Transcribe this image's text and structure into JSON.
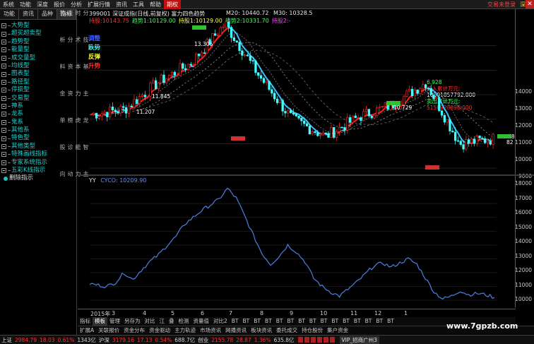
{
  "menu": {
    "items": [
      "系统",
      "功能",
      "深度",
      "报价",
      "分析",
      "扩展行情",
      "资讯",
      "工具",
      "帮助",
      "期权"
    ],
    "active_index": 9,
    "right_items": [
      "交易未登录",
      "深证"
    ]
  },
  "sidebar": {
    "tabs": [
      "功能",
      "资讯",
      "品种",
      "指标"
    ],
    "active_tab": 3,
    "tree": [
      {
        "label": "大势型",
        "type": "node"
      },
      {
        "label": "超买超卖型",
        "type": "node"
      },
      {
        "label": "趋势型",
        "type": "node"
      },
      {
        "label": "能量型",
        "type": "node"
      },
      {
        "label": "成交量型",
        "type": "node"
      },
      {
        "label": "均线型",
        "type": "node"
      },
      {
        "label": "图表型",
        "type": "node"
      },
      {
        "label": "路径型",
        "type": "node"
      },
      {
        "label": "停损型",
        "type": "node"
      },
      {
        "label": "交易型",
        "type": "node"
      },
      {
        "label": "神系",
        "type": "node"
      },
      {
        "label": "龙系",
        "type": "node"
      },
      {
        "label": "鬼系",
        "type": "node"
      },
      {
        "label": "其他系",
        "type": "node"
      },
      {
        "label": "特色型",
        "type": "node"
      },
      {
        "label": "其他类型",
        "type": "node"
      },
      {
        "label": "特殊画线指标",
        "type": "node"
      },
      {
        "label": "专家系统指示",
        "type": "node"
      },
      {
        "label": "五彩K线指示",
        "type": "node"
      },
      {
        "label": "删除指示",
        "type": "leaf"
      }
    ]
  },
  "side_vertical_labels": [
    "分时走势",
    "技术分析",
    "基本资料",
    "主力资金",
    "龙虎榜单",
    "智能诊股",
    "主力动向"
  ],
  "upper_header": {
    "code_name": "399001  深证成指(日线,前复权)  富力四色趋势",
    "ma_row": [
      {
        "label": "M20:",
        "value": "10440.72",
        "color": "#e8e8e8"
      },
      {
        "label": "M30:",
        "value": "10328.5",
        "color": "#e8e8e8"
      }
    ],
    "row2": [
      {
        "label": "持股:",
        "value": "10143.75",
        "color": "#ff3030"
      },
      {
        "label": "趋势1:",
        "value": "10129.00",
        "color": "#40ff60"
      },
      {
        "label": "持股1:",
        "value": "10129.00",
        "color": "#ffff40"
      },
      {
        "label": "趋势2:",
        "value": "10331.70",
        "color": "#40ff60"
      },
      {
        "label": "持股2:",
        "value": "-",
        "color": "#ff40ff"
      }
    ]
  },
  "legend": [
    {
      "label": "调整",
      "color": "#4060ff"
    },
    {
      "label": "跌势",
      "color": "#40ffff"
    },
    {
      "label": "反弹",
      "color": "#ffff40"
    },
    {
      "label": "升势",
      "color": "#ff3030"
    }
  ],
  "stats_card": [
    {
      "text": "6.928",
      "color": "#40ff60"
    },
    {
      "text": "买入累计万元:",
      "color": "#ff3030"
    },
    {
      "text": "10301857792.000",
      "color": "#ffffff"
    },
    {
      "text": "卖出累计万元:",
      "color": "#40ff60"
    },
    {
      "text": "5150928896.000",
      "color": "#ff3030"
    }
  ],
  "upper_annotations": [
    "13.306",
    "11.845",
    "11.207",
    "10.729",
    "0.680",
    "82"
  ],
  "upper_yaxis": [
    "14000",
    "13000",
    "12000",
    "11000",
    "10000",
    "9000"
  ],
  "lower_header": {
    "label": "YY",
    "series": "CYCO: 10209.90"
  },
  "lower_yaxis": [
    "18000",
    "17000",
    "16000",
    "15000",
    "14000",
    "13000",
    "12000",
    "11000",
    "10000"
  ],
  "xaxis": [
    "2015年",
    "3",
    "4",
    "5",
    "6",
    "7",
    "8",
    "9",
    "10",
    "11",
    "12",
    "1"
  ],
  "tabs_row1": [
    "指标",
    "模板",
    "管理",
    "另存为",
    "对比",
    "江",
    "叠",
    "检测",
    "资量",
    "资",
    "对比2",
    "叠",
    "叠",
    "叠",
    "叠",
    "叠",
    "叠",
    "叠",
    "叠",
    "叠",
    "叠",
    "叠",
    "叠",
    "叠",
    "叠",
    "叠"
  ],
  "tabs_row1_labels": [
    "指标",
    "模板",
    "管理",
    "另存为",
    "对比",
    "江",
    "叠",
    "检测",
    "资量值",
    "对比2",
    "BT",
    "BT",
    "BT",
    "BT",
    "BT",
    "BT",
    "BT",
    "BT",
    "BT",
    "BT",
    "BT",
    "BT",
    "BT",
    "BT",
    "BT"
  ],
  "tabs_row2": [
    "扩展A",
    "关联报价",
    "资金分布",
    "资金驱动",
    "主力轨迹",
    "市场资讯",
    "网播资讯",
    "板块资讯",
    "委托成交",
    "持仓股份",
    "集户资金"
  ],
  "status": {
    "items": [
      {
        "text": "上证",
        "cls": "lbl"
      },
      {
        "text": "2984.79",
        "cls": "up"
      },
      {
        "text": "18.03",
        "cls": "up"
      },
      {
        "text": "0.61%",
        "cls": "up"
      },
      {
        "text": "1343亿",
        "cls": "vol"
      },
      {
        "text": "沪深",
        "cls": "lbl"
      },
      {
        "text": "3179.16",
        "cls": "up"
      },
      {
        "text": "17.13",
        "cls": "up"
      },
      {
        "text": "0.54%",
        "cls": "up"
      },
      {
        "text": "688.7亿",
        "cls": "vol"
      },
      {
        "text": "创业",
        "cls": "lbl"
      },
      {
        "text": "2155.78",
        "cls": "up"
      },
      {
        "text": "28.87",
        "cls": "up"
      },
      {
        "text": "1.36%",
        "cls": "up"
      },
      {
        "text": "635.8亿",
        "cls": "vol"
      }
    ],
    "ad": "VIP_招商广州3"
  },
  "watermark": "www.7gpzb.com",
  "colors": {
    "up": "#ff3030",
    "down": "#40ffff",
    "bg": "#000000",
    "lower_line": "#4f7fe0"
  },
  "chart_data": [
    {
      "type": "line",
      "title": "399001 深证成指(日线,前复权) 富力四色趋势",
      "xlabel": "",
      "ylabel": "",
      "categories": [
        "2015-02",
        "2015-03",
        "2015-04",
        "2015-05",
        "2015-06",
        "2015-07",
        "2015-08",
        "2015-09",
        "2015-10",
        "2015-11",
        "2015-12",
        "2016-01",
        "2016-02"
      ],
      "ylim": [
        8800,
        15200
      ],
      "series": [
        {
          "name": "",
          "values": [
            11200,
            11400,
            12500,
            13300,
            14900,
            12800,
            11000,
            10300,
            11100,
            11600,
            12500,
            10000,
            10200
          ]
        }
      ]
    },
    {
      "type": "line",
      "title": "",
      "series_label": "CYCO: 10209.90",
      "ylim": [
        9700,
        18700
      ],
      "x_count": 48,
      "series": [
        {
          "name": "CYCO",
          "values": [
            11200,
            11100,
            11000,
            11300,
            12000,
            11500,
            12200,
            12800,
            13300,
            14000,
            14600,
            15500,
            16000,
            16500,
            16900,
            17300,
            18100,
            17400,
            16100,
            14700,
            13400,
            12600,
            13200,
            14000,
            13500,
            12800,
            11600,
            11000,
            10600,
            10300,
            10800,
            11300,
            11900,
            12500,
            12700,
            12400,
            12700,
            13000,
            12600,
            11600,
            10600,
            10100,
            10300,
            10700,
            10400,
            10500,
            10400,
            10200
          ]
        }
      ]
    }
  ]
}
